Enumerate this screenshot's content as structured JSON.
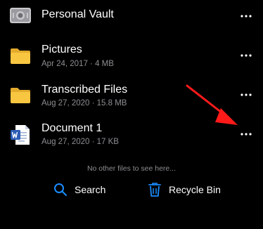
{
  "files": [
    {
      "name": "Personal Vault",
      "meta": "",
      "icon": "vault-icon"
    },
    {
      "name": "Pictures",
      "meta": "Apr 24, 2017 · 4 MB",
      "icon": "folder-icon"
    },
    {
      "name": "Transcribed Files",
      "meta": "Aug 27, 2020 · 15.8 MB",
      "icon": "folder-icon"
    },
    {
      "name": "Document 1",
      "meta": "Aug 27, 2020 · 17 KB",
      "icon": "word-document-icon"
    }
  ],
  "empty_note": "No other files to see here...",
  "actions": {
    "search_label": "Search",
    "recycle_label": "Recycle Bin"
  },
  "colors": {
    "background": "#000000",
    "folder": "#f8c641",
    "accent": "#1a8cff",
    "annotation": "#ff1a1a",
    "secondary_text": "#8e8e93"
  },
  "icons": {
    "more": "more-horizontal-icon",
    "search": "search-icon",
    "recycle": "trash-icon",
    "annotation": "red-arrow"
  }
}
